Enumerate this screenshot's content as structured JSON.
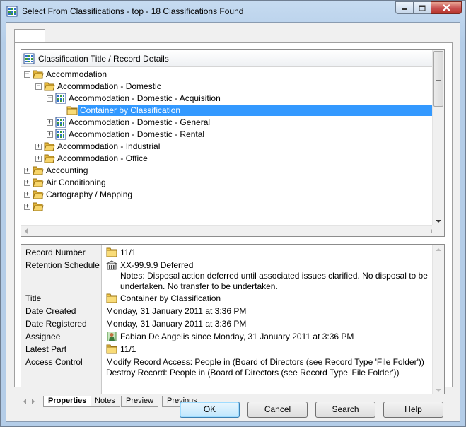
{
  "window": {
    "title": "Select From Classifications - top - 18 Classifications Found"
  },
  "tree": {
    "header": "Classification Title / Record Details",
    "rows": [
      {
        "label": "Accommodation",
        "expander": "−",
        "icon": "folder-open-icon"
      },
      {
        "label": "Accommodation - Domestic",
        "expander": "−",
        "icon": "folder-open-icon"
      },
      {
        "label": "Accommodation - Domestic - Acquisition",
        "expander": "−",
        "icon": "classification-grid-icon"
      },
      {
        "label": "Container by Classification",
        "expander": "",
        "icon": "folder-closed-icon",
        "selected": true
      },
      {
        "label": "Accommodation - Domestic - General",
        "expander": "+",
        "icon": "classification-grid-icon"
      },
      {
        "label": "Accommodation - Domestic - Rental",
        "expander": "+",
        "icon": "classification-grid-icon"
      },
      {
        "label": "Accommodation - Industrial",
        "expander": "+",
        "icon": "folder-open-icon"
      },
      {
        "label": "Accommodation - Office",
        "expander": "+",
        "icon": "folder-open-icon"
      },
      {
        "label": "Accounting",
        "expander": "+",
        "icon": "folder-open-icon"
      },
      {
        "label": "Air Conditioning",
        "expander": "+",
        "icon": "folder-open-icon"
      },
      {
        "label": "Cartography / Mapping",
        "expander": "+",
        "icon": "folder-open-icon"
      }
    ]
  },
  "details": {
    "record_number": {
      "label": "Record Number",
      "value": "11/1"
    },
    "retention_schedule": {
      "label": "Retention Schedule",
      "value": "XX-99.9.9 Deferred",
      "notes": "Notes: Disposal action deferred until associated issues clarified.  No disposal to be undertaken.  No transfer to be undertaken."
    },
    "title": {
      "label": "Title",
      "value": "Container by Classification"
    },
    "date_created": {
      "label": "Date Created",
      "value": "Monday, 31 January 2011 at 3:36 PM"
    },
    "date_registered": {
      "label": "Date Registered",
      "value": "Monday, 31 January 2011 at 3:36 PM"
    },
    "assignee": {
      "label": "Assignee",
      "value": "Fabian De Angelis since Monday, 31 January 2011 at 3:36 PM"
    },
    "latest_part": {
      "label": "Latest Part",
      "value": "11/1"
    },
    "access_control": {
      "label": "Access Control",
      "line1": "Modify Record Access: People in (Board of Directors (see Record Type 'File Folder'))",
      "line2": "Destroy Record: People in (Board of Directors (see Record Type 'File Folder'))"
    }
  },
  "bottom_tabs": [
    "Properties",
    "Notes",
    "Preview",
    "Previous"
  ],
  "buttons": {
    "ok": "OK",
    "cancel": "Cancel",
    "search": "Search",
    "help": "Help"
  },
  "colors": {
    "selection": "#3399ff",
    "folder": "#f3c94a",
    "window_frame": "#b4cde8"
  }
}
